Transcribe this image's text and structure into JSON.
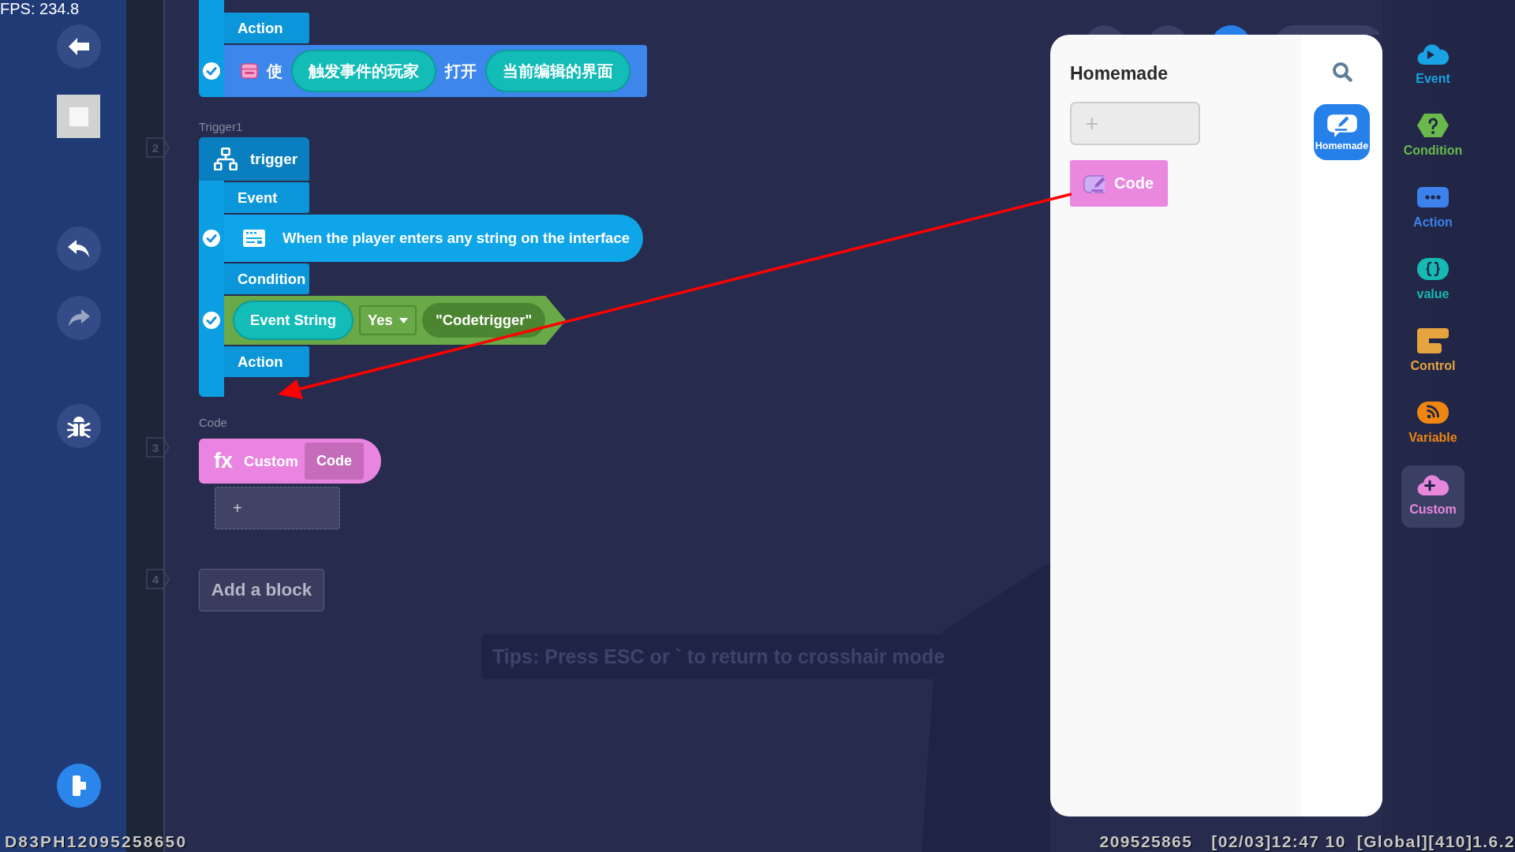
{
  "status_overlay": {
    "fps": "FPS: 234.8",
    "device_id": "D83PH12095258650",
    "info": [
      "209525865",
      "[02/03]12:47 10",
      "[Global][410]1.6.2"
    ]
  },
  "sidebar": {
    "buttons": [
      {
        "kind": "back",
        "disabled": false
      },
      {
        "kind": "thumbnail",
        "disabled": false
      },
      {
        "kind": "undo",
        "disabled": false
      },
      {
        "kind": "redo",
        "disabled": true
      },
      {
        "kind": "debug",
        "disabled": false
      },
      {
        "kind": "run",
        "disabled": false
      }
    ]
  },
  "scripts": [
    {
      "kind": "trigger",
      "clauses": [
        {
          "kind": "tab",
          "label": "Action"
        },
        {
          "kind": "action",
          "checked": true,
          "parts": [
            {
              "kind": "icon"
            },
            {
              "kind": "word",
              "text": "使"
            },
            {
              "kind": "slot",
              "text": "触发事件的玩家"
            },
            {
              "kind": "word",
              "text": "打开"
            },
            {
              "kind": "slot",
              "text": "当前编辑的界面"
            }
          ]
        }
      ]
    },
    {
      "kind": "trigger",
      "number": "2",
      "label": "Trigger1",
      "header": "trigger",
      "clauses": [
        {
          "kind": "tab",
          "label": "Event"
        },
        {
          "kind": "event",
          "checked": true,
          "parts": [
            {
              "kind": "icon"
            },
            {
              "kind": "word",
              "text": "When the player enters any string on the interface"
            }
          ]
        },
        {
          "kind": "tab",
          "label": "Condition"
        },
        {
          "kind": "condition",
          "checked": true,
          "parts": [
            {
              "kind": "slot",
              "text": "Event String"
            },
            {
              "kind": "dropdown",
              "text": "Yes"
            },
            {
              "kind": "string",
              "text": "\"Codetrigger\""
            }
          ]
        },
        {
          "kind": "tab",
          "label": "Action"
        }
      ]
    },
    {
      "kind": "custom",
      "number": "3",
      "label": "Code",
      "custom": {
        "prefix": "fx",
        "title": "Custom",
        "name": "Code"
      },
      "drop_slot": "+"
    },
    {
      "kind": "empty",
      "number": "4",
      "add_button": "Add a block"
    }
  ],
  "tips": "Tips: Press ESC or ` to return to crosshair mode",
  "top_toolbar": [
    {
      "kind": "round",
      "selected": false
    },
    {
      "kind": "round",
      "selected": false
    },
    {
      "kind": "round",
      "selected": true
    },
    {
      "kind": "wide",
      "selected": false
    }
  ],
  "panel": {
    "title": "Homemade",
    "new_block": "+",
    "blocks": [
      {
        "label": "Code"
      }
    ],
    "tabs": [
      {
        "label": "Homemade",
        "selected": true
      }
    ]
  },
  "categories": [
    {
      "kind": "event",
      "label": "Event",
      "color": "#18a4e4",
      "selected": false
    },
    {
      "kind": "condition",
      "label": "Condition",
      "color": "#6ab94b",
      "selected": false
    },
    {
      "kind": "action",
      "label": "Action",
      "color": "#3d82ec",
      "selected": false
    },
    {
      "kind": "value",
      "label": "value",
      "color": "#17bab2",
      "selected": false
    },
    {
      "kind": "control",
      "label": "Control",
      "color": "#e5a43e",
      "selected": false
    },
    {
      "kind": "variable",
      "label": "Variable",
      "color": "#ef8611",
      "selected": false
    },
    {
      "kind": "custom",
      "label": "Custom",
      "color": "#e886dc",
      "selected": true
    }
  ]
}
